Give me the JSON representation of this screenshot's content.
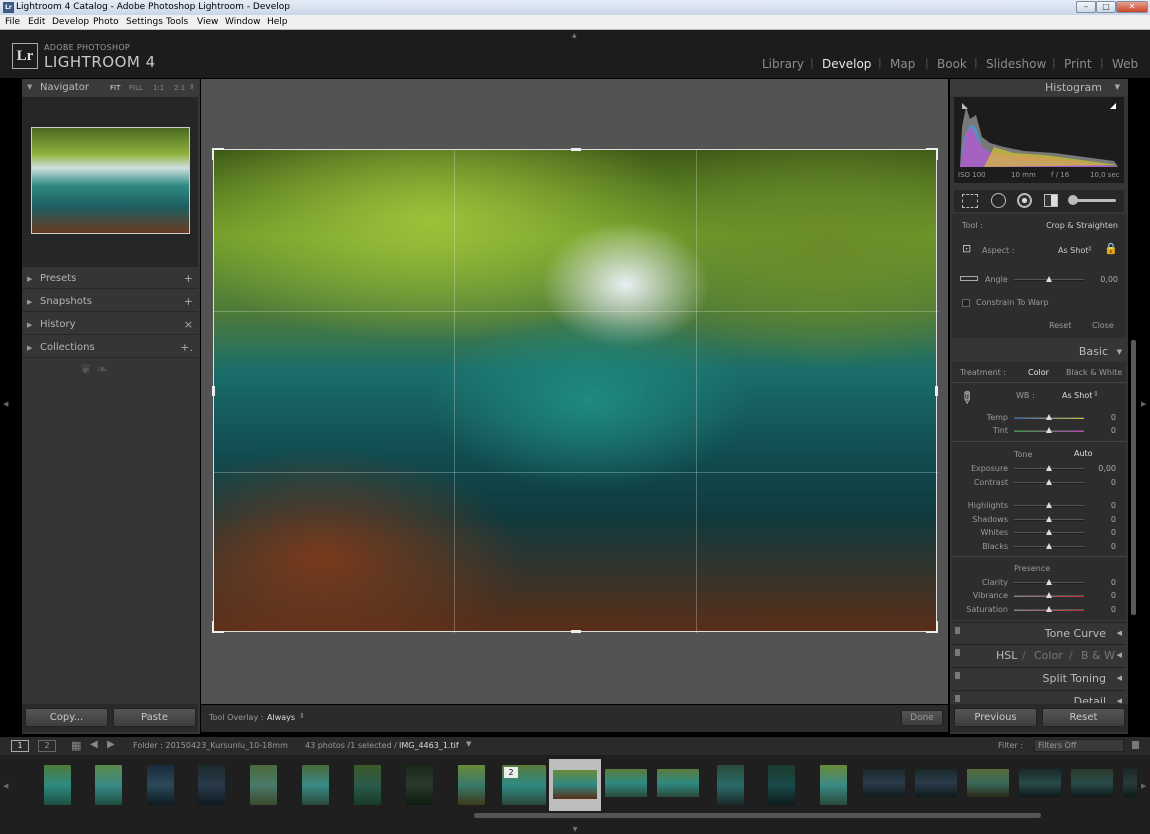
{
  "window": {
    "title": "Lightroom 4 Catalog - Adobe Photoshop Lightroom - Develop",
    "app_icon": "Lr"
  },
  "menu": [
    "File",
    "Edit",
    "Develop",
    "Photo",
    "Settings",
    "Tools",
    "View",
    "Window",
    "Help"
  ],
  "brand": {
    "small": "ADOBE PHOTOSHOP",
    "big": "LIGHTROOM 4",
    "logo": "Lr"
  },
  "modules": [
    "Library",
    "Develop",
    "Map",
    "Book",
    "Slideshow",
    "Print",
    "Web"
  ],
  "active_module": "Develop",
  "navigator": {
    "title": "Navigator",
    "zoom": [
      "FIT",
      "FILL",
      "1:1",
      "2:1"
    ]
  },
  "left_panels": [
    {
      "label": "Presets",
      "action": "+"
    },
    {
      "label": "Snapshots",
      "action": "+"
    },
    {
      "label": "History",
      "action": "×"
    },
    {
      "label": "Collections",
      "action": "+."
    }
  ],
  "left_buttons": {
    "copy": "Copy...",
    "paste": "Paste"
  },
  "toolbar": {
    "overlay_label": "Tool Overlay :",
    "overlay_value": "Always",
    "done": "Done"
  },
  "histogram": {
    "title": "Histogram",
    "iso": "ISO 100",
    "focal": "10 mm",
    "aperture": "f / 16",
    "shutter": "10,0 sec"
  },
  "crop": {
    "tool_label": "Tool :",
    "tool_name": "Crop & Straighten",
    "aspect_label": "Aspect :",
    "aspect_value": "As Shot",
    "angle_label": "Angle",
    "angle_value": "0,00",
    "constrain": "Constrain To Warp",
    "reset": "Reset",
    "close": "Close"
  },
  "basic": {
    "title": "Basic",
    "treatment_label": "Treatment :",
    "color": "Color",
    "bw": "Black & White",
    "wb_label": "WB :",
    "wb_value": "As Shot",
    "temp_label": "Temp",
    "temp": "0",
    "tint_label": "Tint",
    "tint": "0",
    "tone_label": "Tone",
    "auto": "Auto",
    "exposure_label": "Exposure",
    "exposure": "0,00",
    "contrast_label": "Contrast",
    "contrast": "0",
    "highlights_label": "Highlights",
    "highlights": "0",
    "shadows_label": "Shadows",
    "shadows": "0",
    "whites_label": "Whites",
    "whites": "0",
    "blacks_label": "Blacks",
    "blacks": "0",
    "presence_label": "Presence",
    "clarity_label": "Clarity",
    "clarity": "0",
    "vibrance_label": "Vibrance",
    "vibrance": "0",
    "saturation_label": "Saturation",
    "saturation": "0"
  },
  "right_panels": {
    "tone_curve": "Tone Curve",
    "hsl": "HSL",
    "hsl_sep": "/",
    "color": "Color",
    "bw": "B & W",
    "split": "Split Toning",
    "detail": "Detail"
  },
  "right_buttons": {
    "previous": "Previous",
    "reset": "Reset"
  },
  "filmbar": {
    "page1": "1",
    "page2": "2",
    "folder": "Folder : 20150423_Kursunlu_10-18mm",
    "count": "43 photos /1 selected /",
    "file": "IMG_4463_1.tif",
    "filter_label": "Filter :",
    "filter_value": "Filters Off"
  },
  "selected_badge": "2",
  "colors": {
    "panel": "#353535",
    "center": "#535353",
    "section": "#2d2d2d",
    "active": "#e8e8e8"
  }
}
